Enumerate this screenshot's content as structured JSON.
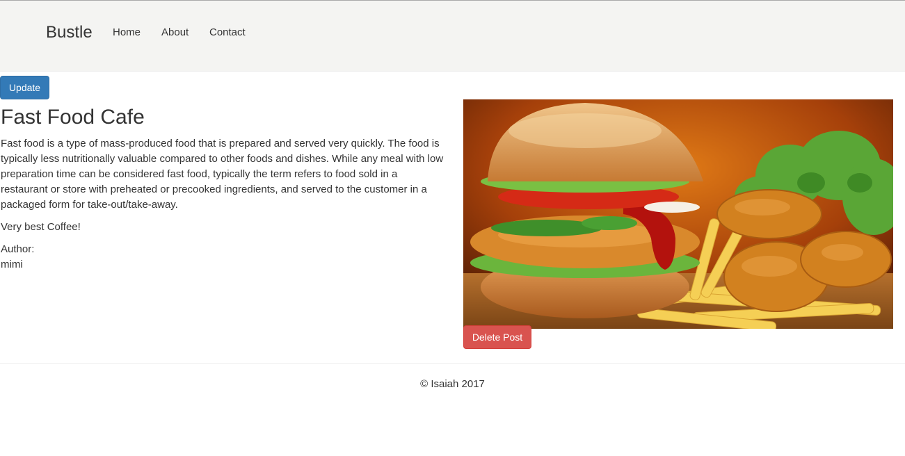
{
  "navbar": {
    "brand": "Bustle",
    "links": [
      "Home",
      "About",
      "Contact"
    ]
  },
  "post": {
    "update_label": "Update",
    "title": "Fast Food Cafe",
    "description": "Fast food is a type of mass-produced food that is prepared and served very quickly. The food is typically less nutritionally valuable compared to other foods and dishes. While any meal with low preparation time can be considered fast food, typically the term refers to food sold in a restaurant or store with preheated or precooked ingredients, and served to the customer in a packaged form for take-out/take-away.",
    "tagline": "Very best Coffee!",
    "author_label": "Author:",
    "author": "mimi",
    "delete_label": "Delete Post"
  },
  "footer": {
    "copyright": "© Isaiah 2017"
  },
  "colors": {
    "primary": "#337ab7",
    "danger": "#d9534f",
    "navbar_bg": "#f4f4f2"
  }
}
